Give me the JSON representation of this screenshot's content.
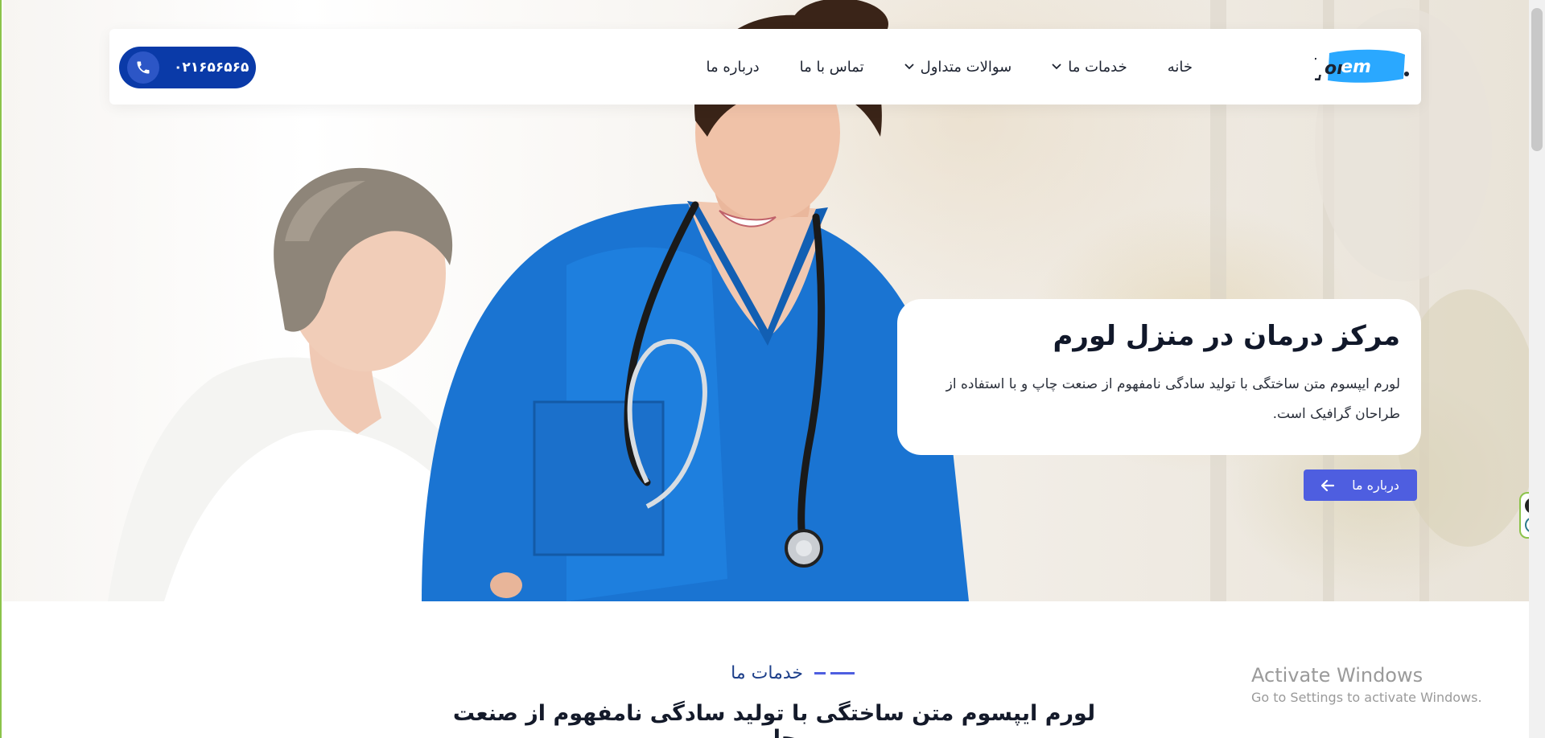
{
  "logo": {
    "text": "Lorem",
    "colors": {
      "primary": "#1e90ff",
      "dark": "#1c2230"
    }
  },
  "nav": {
    "items": [
      {
        "label": "خانه",
        "has_dropdown": false
      },
      {
        "label": "خدمات ما",
        "has_dropdown": true
      },
      {
        "label": "سوالات متداول",
        "has_dropdown": true
      },
      {
        "label": "تماس با ما",
        "has_dropdown": false
      },
      {
        "label": "درباره ما",
        "has_dropdown": false
      }
    ],
    "phone": {
      "number": "۰۲۱۶۵۶۵۶۵",
      "icon": "phone-icon",
      "color": "#0a3aa8"
    }
  },
  "hero": {
    "title": "مرکز درمان در منزل لورم",
    "text": "لورم ایپسوم متن ساختگی با تولید سادگی نامفهوم از صنعت چاپ و با استفاده از طراحان گرافیک است.",
    "button": {
      "label": "درباره ما",
      "icon": "arrow-left-icon",
      "color": "#4e5ee0"
    }
  },
  "services": {
    "label": "خدمات ما",
    "title": "لورم ایپسوم متن ساختگی با تولید سادگی نامفهوم از صنعت چاپ"
  },
  "windows_watermark": {
    "line1": "Activate Windows",
    "line2": "Go to Settings to activate Windows."
  },
  "floating_tool": {
    "icons": [
      "close-icon",
      "e-icon"
    ]
  }
}
